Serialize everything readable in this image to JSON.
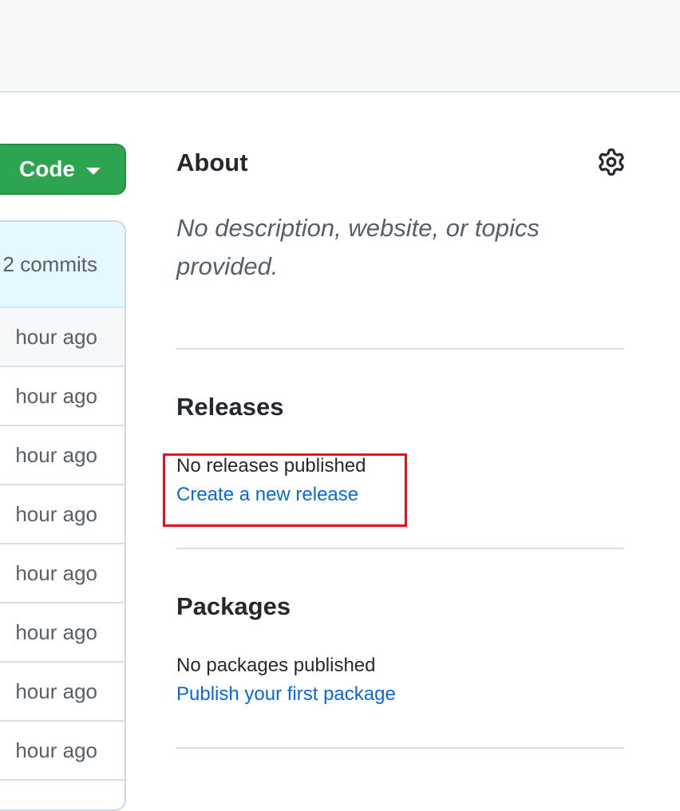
{
  "repo": {
    "code_button_label": "Code",
    "commits_label": "2 commits",
    "file_rows": [
      {
        "age": "hour ago"
      },
      {
        "age": "hour ago"
      },
      {
        "age": "hour ago"
      },
      {
        "age": "hour ago"
      },
      {
        "age": "hour ago"
      },
      {
        "age": "hour ago"
      },
      {
        "age": "hour ago"
      },
      {
        "age": "hour ago"
      }
    ]
  },
  "about": {
    "title": "About",
    "description": "No description, website, or topics provided.",
    "settings_icon": "gear-icon"
  },
  "releases": {
    "title": "Releases",
    "status": "No releases published",
    "link": "Create a new release"
  },
  "packages": {
    "title": "Packages",
    "status": "No packages published",
    "link": "Publish your first package"
  },
  "colors": {
    "primary_button": "#2da44e",
    "link": "#0969da",
    "highlight": "#e8101f"
  }
}
